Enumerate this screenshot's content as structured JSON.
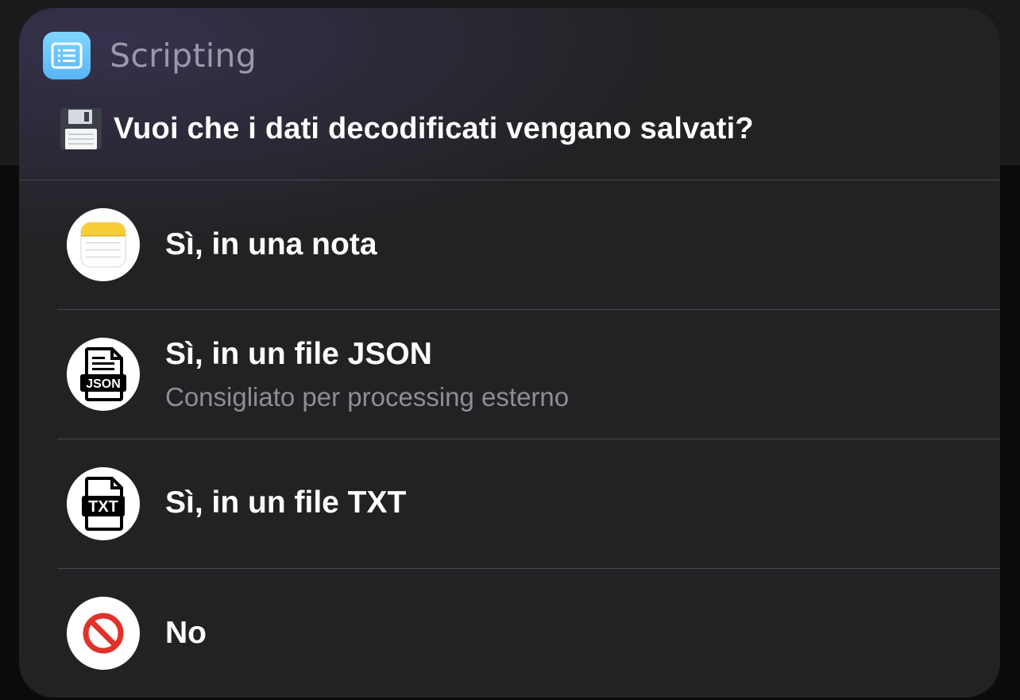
{
  "header": {
    "app_name": "Scripting",
    "app_icon": "scripting-list-icon",
    "prompt_icon": "floppy-disk-icon",
    "prompt": "Vuoi che i dati decodificati vengano salvati?"
  },
  "options": [
    {
      "title": "Sì, in una nota",
      "subtitle": "",
      "icon": "notes-app-icon"
    },
    {
      "title": "Sì, in un file JSON",
      "subtitle": "Consigliato per processing esterno",
      "icon": "json-file-icon",
      "icon_text": "JSON"
    },
    {
      "title": "Sì, in un file TXT",
      "subtitle": "",
      "icon": "txt-file-icon",
      "icon_text": "TXT"
    },
    {
      "title": "No",
      "subtitle": "",
      "icon": "prohibited-icon"
    }
  ],
  "colors": {
    "panel_background": "#222224",
    "app_icon": "#6cc4fa",
    "app_name": "#9c98ab",
    "subtitle": "#8e8e93",
    "prohibited": "#e0322b"
  }
}
